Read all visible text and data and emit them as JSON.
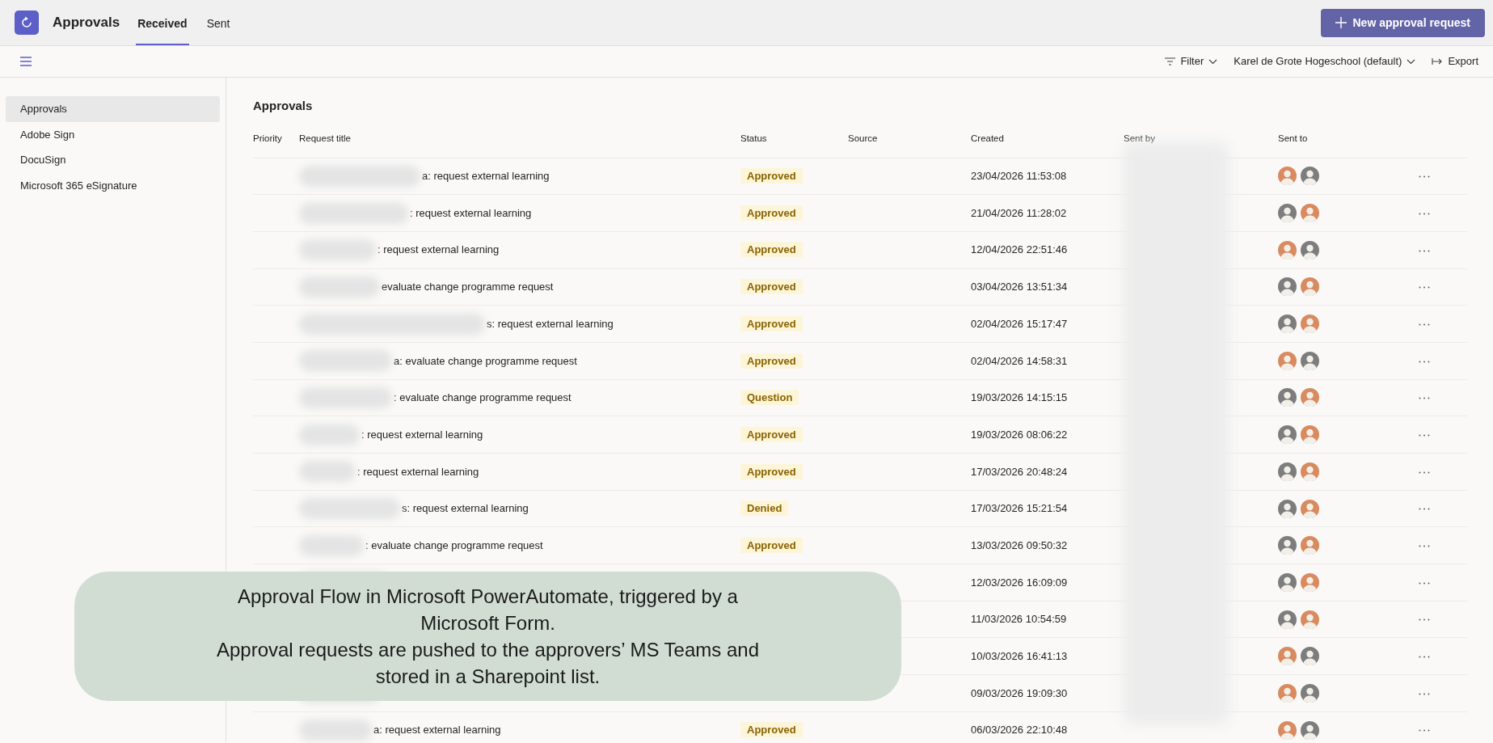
{
  "app": {
    "title": "Approvals",
    "tabs": [
      {
        "label": "Received",
        "selected": true
      },
      {
        "label": "Sent",
        "selected": false
      }
    ],
    "new_button": "New approval request"
  },
  "toolbar": {
    "filter": "Filter",
    "environment": "Karel de Grote Hogeschool (default)",
    "export": "Export"
  },
  "sidebar": {
    "items": [
      {
        "label": "Approvals",
        "selected": true
      },
      {
        "label": "Adobe Sign",
        "selected": false
      },
      {
        "label": "DocuSign",
        "selected": false
      },
      {
        "label": "Microsoft 365 eSignature",
        "selected": false
      }
    ]
  },
  "table": {
    "title": "Approvals",
    "columns": [
      "Priority",
      "Request title",
      "Status",
      "Source",
      "Created",
      "Sent by",
      "Sent to"
    ],
    "rows": [
      {
        "title": "a: request external learning",
        "status": "Approved",
        "created": "23/04/2026 11:53:08",
        "sent_to": [
          {
            "color": "#d98a5e"
          },
          {
            "color": "#7d7d7d"
          }
        ]
      },
      {
        "title": ": request external learning",
        "status": "Approved",
        "created": "21/04/2026 11:28:02",
        "sent_to": [
          {
            "color": "#7d7d7d"
          },
          {
            "color": "#d98a5e"
          }
        ]
      },
      {
        "title": ": request external learning",
        "status": "Approved",
        "created": "12/04/2026 22:51:46",
        "sent_to": [
          {
            "color": "#d98a5e"
          },
          {
            "color": "#7d7d7d"
          }
        ]
      },
      {
        "title": "evaluate change programme request",
        "status": "Approved",
        "created": "03/04/2026 13:51:34",
        "sent_to": [
          {
            "color": "#7d7d7d"
          },
          {
            "color": "#d98a5e"
          }
        ]
      },
      {
        "title": "s: request external learning",
        "status": "Approved",
        "created": "02/04/2026 15:17:47",
        "sent_to": [
          {
            "color": "#7d7d7d"
          },
          {
            "color": "#d98a5e"
          }
        ]
      },
      {
        "title": "a: evaluate change programme request",
        "status": "Approved",
        "created": "02/04/2026 14:58:31",
        "sent_to": [
          {
            "color": "#d98a5e"
          },
          {
            "color": "#7d7d7d"
          }
        ]
      },
      {
        "title": ": evaluate change programme request",
        "status": "Question",
        "created": "19/03/2026 14:15:15",
        "sent_to": [
          {
            "color": "#7d7d7d"
          },
          {
            "color": "#d98a5e"
          }
        ]
      },
      {
        "title": ": request external learning",
        "status": "Approved",
        "created": "19/03/2026 08:06:22",
        "sent_to": [
          {
            "color": "#7d7d7d"
          },
          {
            "color": "#d98a5e"
          }
        ]
      },
      {
        "title": ": request external learning",
        "status": "Approved",
        "created": "17/03/2026 20:48:24",
        "sent_to": [
          {
            "color": "#7d7d7d"
          },
          {
            "color": "#d98a5e"
          }
        ]
      },
      {
        "title": "s: request external learning",
        "status": "Denied",
        "created": "17/03/2026 15:21:54",
        "sent_to": [
          {
            "color": "#7d7d7d"
          },
          {
            "color": "#d98a5e"
          }
        ]
      },
      {
        "title": ": evaluate change programme request",
        "status": "Approved",
        "created": "13/03/2026 09:50:32",
        "sent_to": [
          {
            "color": "#7d7d7d"
          },
          {
            "color": "#d98a5e"
          }
        ]
      },
      {
        "created": "12/03/2026 16:09:09",
        "sent_to": [
          {
            "color": "#7d7d7d"
          },
          {
            "color": "#d98a5e"
          }
        ]
      },
      {
        "created": "11/03/2026 10:54:59",
        "sent_to": [
          {
            "color": "#7d7d7d"
          },
          {
            "color": "#d98a5e"
          }
        ]
      },
      {
        "created": "10/03/2026 16:41:13",
        "sent_to": [
          {
            "color": "#d98a5e"
          },
          {
            "color": "#7d7d7d"
          }
        ]
      },
      {
        "created": "09/03/2026 19:09:30",
        "sent_to": [
          {
            "color": "#d98a5e"
          },
          {
            "color": "#7d7d7d"
          }
        ]
      },
      {
        "title": "a: request external learning",
        "status": "Approved",
        "created": "06/03/2026 22:10:48",
        "sent_to": [
          {
            "color": "#d98a5e"
          },
          {
            "color": "#7d7d7d"
          }
        ]
      }
    ]
  },
  "caption": [
    "Approval Flow in Microsoft PowerAutomate, triggered by a Microsoft Form.",
    "Approval requests are pushed to the approvers’ MS Teams and stored in a Sharepoint list."
  ]
}
